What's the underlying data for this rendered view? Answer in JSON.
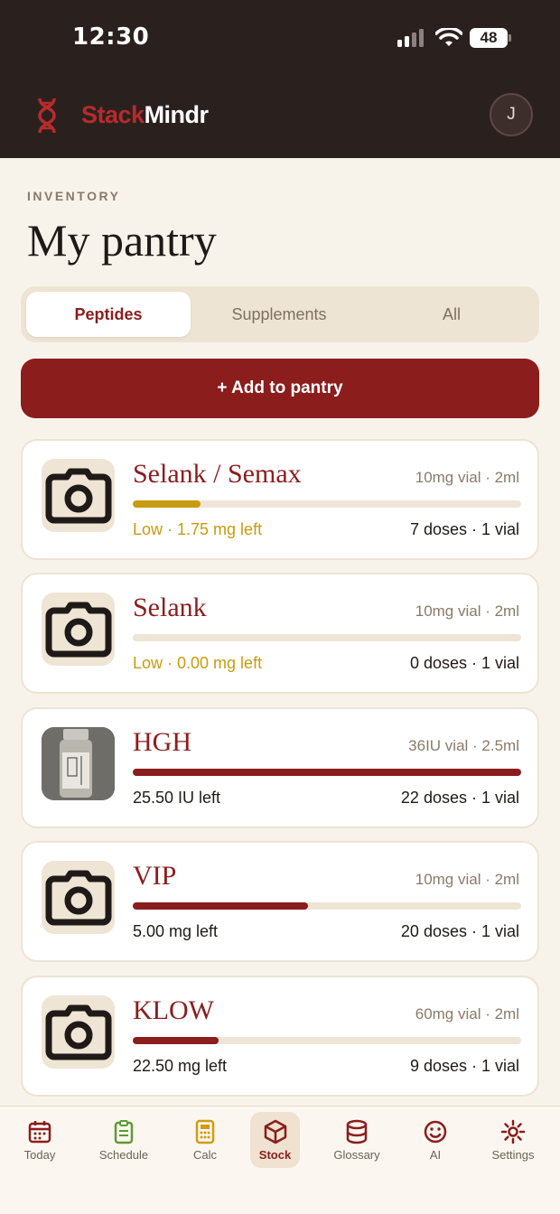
{
  "status_bar": {
    "time": "12:30",
    "battery": "48"
  },
  "header": {
    "brand_part1": "Stack",
    "brand_part2": "Mindr",
    "avatar_initial": "J"
  },
  "page": {
    "eyebrow": "INVENTORY",
    "title": "My pantry"
  },
  "segments": [
    {
      "label": "Peptides",
      "active": true
    },
    {
      "label": "Supplements",
      "active": false
    },
    {
      "label": "All",
      "active": false
    }
  ],
  "add_button": "+ Add to pantry",
  "items": [
    {
      "name": "Selank / Semax",
      "spec": "10mg vial · 2ml",
      "remaining": "Low · 1.75 mg left",
      "low": true,
      "doses": "7 doses · 1 vial",
      "level": 0.175,
      "photo": false
    },
    {
      "name": "Selank",
      "spec": "10mg vial · 2ml",
      "remaining": "Low · 0.00 mg left",
      "low": true,
      "doses": "0 doses · 1 vial",
      "level": 0.0,
      "photo": false
    },
    {
      "name": "HGH",
      "spec": "36IU vial · 2.5ml",
      "remaining": "25.50 IU left",
      "low": false,
      "doses": "22 doses · 1 vial",
      "level": 1.0,
      "photo": true
    },
    {
      "name": "VIP",
      "spec": "10mg vial · 2ml",
      "remaining": "5.00 mg left",
      "low": false,
      "doses": "20 doses · 1 vial",
      "level": 0.45,
      "photo": false
    },
    {
      "name": "KLOW",
      "spec": "60mg vial · 2ml",
      "remaining": "22.50 mg left",
      "low": false,
      "doses": "9 doses · 1 vial",
      "level": 0.22,
      "photo": false
    }
  ],
  "colors": {
    "brand_red": "#8b1d1d",
    "low_yellow": "#c99b0e",
    "header_dark": "#2a211f",
    "background": "#f8f3ea"
  },
  "tabs": [
    {
      "label": "Today",
      "icon": "calendar-icon",
      "active": false
    },
    {
      "label": "Schedule",
      "icon": "clipboard-icon",
      "active": false
    },
    {
      "label": "Calc",
      "icon": "calculator-icon",
      "active": false
    },
    {
      "label": "Stock",
      "icon": "box-icon",
      "active": true
    },
    {
      "label": "Glossary",
      "icon": "database-icon",
      "active": false
    },
    {
      "label": "AI",
      "icon": "smiley-icon",
      "active": false
    },
    {
      "label": "Settings",
      "icon": "gear-icon",
      "active": false
    }
  ]
}
